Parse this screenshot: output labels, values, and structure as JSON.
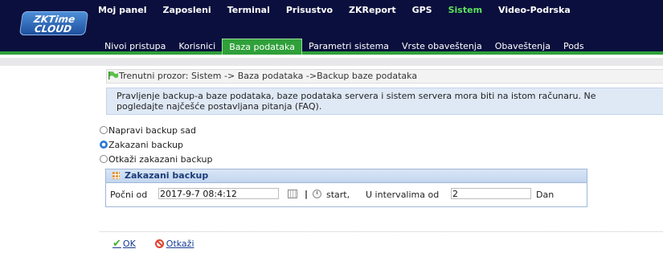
{
  "header": {
    "logo_text": "ZKTime CLOUD",
    "nav": [
      "Moj panel",
      "Zaposleni",
      "Terminal",
      "Prisustvo",
      "ZKReport",
      "GPS",
      "Sistem",
      "Video-Podrska"
    ],
    "active_nav": "Sistem",
    "active_color": "#5ee25e"
  },
  "subnav": {
    "tabs": [
      "Nivoi pristupa",
      "Korisnici",
      "Baza podataka",
      "Parametri sistema",
      "Vrste obaveštenja",
      "Obaveštenja",
      "Pods"
    ],
    "active": "Baza podataka"
  },
  "breadcrumb": "Trenutni prozor: Sistem -> Baza podataka ->Backup baze podataka",
  "info": {
    "line1": "Pravljenje backup-a baze podataka, baze podataka servera i sistem servera mora biti na istom računaru. Ne",
    "line2": "pogledajte najčešće postavljana pitanja (FAQ)."
  },
  "radios": [
    {
      "label": "Napravi backup sad",
      "checked": false
    },
    {
      "label": "Zakazani backup",
      "checked": true
    },
    {
      "label": "Otkaži zakazani backup",
      "checked": false
    }
  ],
  "panel": {
    "title": "Zakazani backup",
    "start_label": "Počni od",
    "start_value": "2017-9-7 08:4:12",
    "separator": "|",
    "start_text": "start,",
    "interval_label": "U intervalima od",
    "interval_value": "2",
    "unit": "Dan"
  },
  "actions": {
    "ok": "OK",
    "cancel": "Otkaži"
  },
  "colors": {
    "header_bg": "#0b0f3d",
    "tab_active": "#2fa03a",
    "info_bg": "#dfe9f6"
  }
}
